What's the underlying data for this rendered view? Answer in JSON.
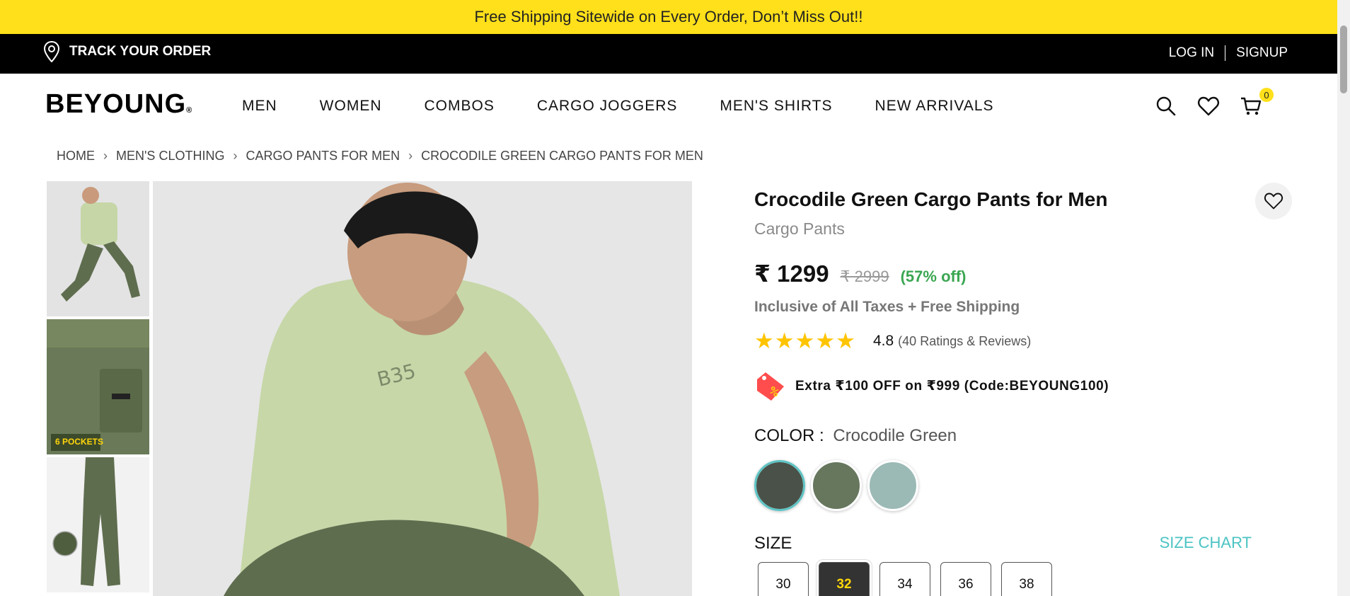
{
  "promo": {
    "text": "Free Shipping Sitewide on Every Order, Don’t Miss Out!!"
  },
  "topbar": {
    "track_label": "TRACK YOUR ORDER",
    "login": "LOG IN",
    "signup": "SIGNUP"
  },
  "nav": {
    "logo": "BEYOUNG",
    "logo_mark": "®",
    "menu": [
      "MEN",
      "WOMEN",
      "COMBOS",
      "CARGO JOGGERS",
      "MEN'S SHIRTS",
      "NEW ARRIVALS"
    ],
    "cart_count": "0"
  },
  "breadcrumb": [
    "HOME",
    "MEN'S CLOTHING",
    "CARGO PANTS FOR MEN",
    "CROCODILE GREEN CARGO PANTS FOR MEN"
  ],
  "thumbs": {
    "pockets_label": "6 POCKETS"
  },
  "product": {
    "title": "Crocodile Green Cargo Pants for Men",
    "subtitle": "Cargo Pants",
    "price": "₹ 1299",
    "mrp": "₹ 2999",
    "discount": "(57% off)",
    "tax_note": "Inclusive of All Taxes + Free Shipping",
    "stars": "★★★★★",
    "rating": "4.8",
    "rating_count": "(40 Ratings & Reviews)",
    "offer": "Extra ₹100 OFF on ₹999 (Code:BEYOUNG100)",
    "color_label": "COLOR :",
    "color_value": "Crocodile Green",
    "swatches": [
      "#4a5149",
      "#66775e",
      "#9bbab6"
    ],
    "size_label": "SIZE",
    "size_chart": "SIZE CHART",
    "sizes": [
      "30",
      "32",
      "34",
      "36",
      "38"
    ],
    "selected_size": "32"
  },
  "colors": {
    "accent_yellow": "#ffe01a",
    "teal": "#4cc3c3",
    "discount_green": "#3aa651"
  }
}
